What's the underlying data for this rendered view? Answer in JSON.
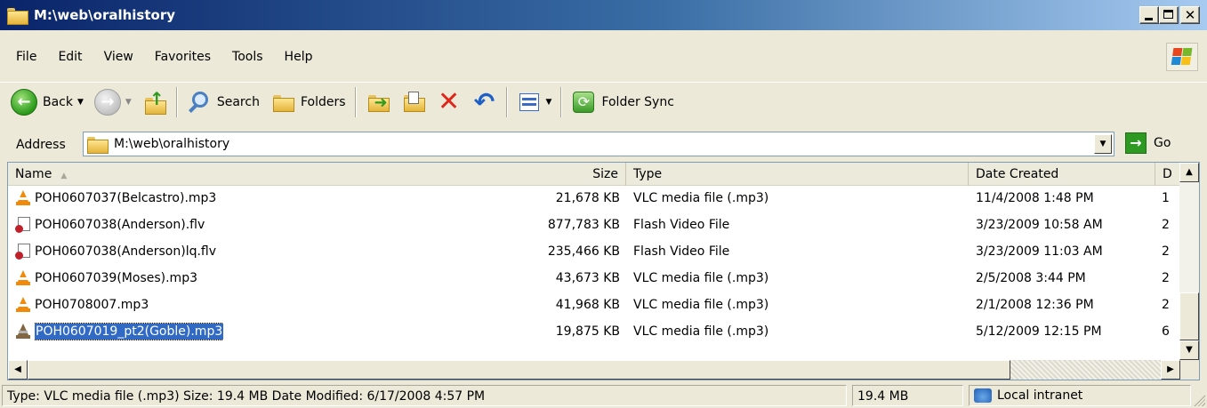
{
  "window": {
    "title": "M:\\web\\oralhistory"
  },
  "menu": [
    "File",
    "Edit",
    "View",
    "Favorites",
    "Tools",
    "Help"
  ],
  "toolbar": {
    "back_label": "Back",
    "search_label": "Search",
    "folders_label": "Folders",
    "folder_sync_label": "Folder Sync"
  },
  "address": {
    "label": "Address",
    "path": "M:\\web\\oralhistory",
    "go_label": "Go"
  },
  "columns": {
    "name": "Name",
    "size": "Size",
    "type": "Type",
    "date_created": "Date Created",
    "truncated": "D"
  },
  "files": [
    {
      "name": "POH0607037(Belcastro).mp3",
      "size": "21,678 KB",
      "type": "VLC media file (.mp3)",
      "date": "11/4/2008 1:48 PM",
      "extra": "1",
      "icon": "vlc-icon"
    },
    {
      "name": "POH0607038(Anderson).flv",
      "size": "877,783 KB",
      "type": "Flash Video File",
      "date": "3/23/2009 10:58 AM",
      "extra": "2",
      "icon": "flash-video-icon"
    },
    {
      "name": "POH0607038(Anderson)lq.flv",
      "size": "235,466 KB",
      "type": "Flash Video File",
      "date": "3/23/2009 11:03 AM",
      "extra": "2",
      "icon": "flash-video-icon"
    },
    {
      "name": "POH0607039(Moses).mp3",
      "size": "43,673 KB",
      "type": "VLC media file (.mp3)",
      "date": "2/5/2008 3:44 PM",
      "extra": "2",
      "icon": "vlc-icon"
    },
    {
      "name": "POH0708007.mp3",
      "size": "41,968 KB",
      "type": "VLC media file (.mp3)",
      "date": "2/1/2008 12:36 PM",
      "extra": "2",
      "icon": "vlc-icon"
    },
    {
      "name": "POH0607019_pt2(Goble).mp3",
      "size": "19,875 KB",
      "type": "VLC media file (.mp3)",
      "date": "5/12/2009 12:15 PM",
      "extra": "6",
      "icon": "vlc-icon",
      "selected": true
    }
  ],
  "status": {
    "info": "Type: VLC media file (.mp3) Size: 19.4 MB Date Modified: 6/17/2008 4:57 PM",
    "size": "19.4 MB",
    "zone": "Local intranet"
  }
}
